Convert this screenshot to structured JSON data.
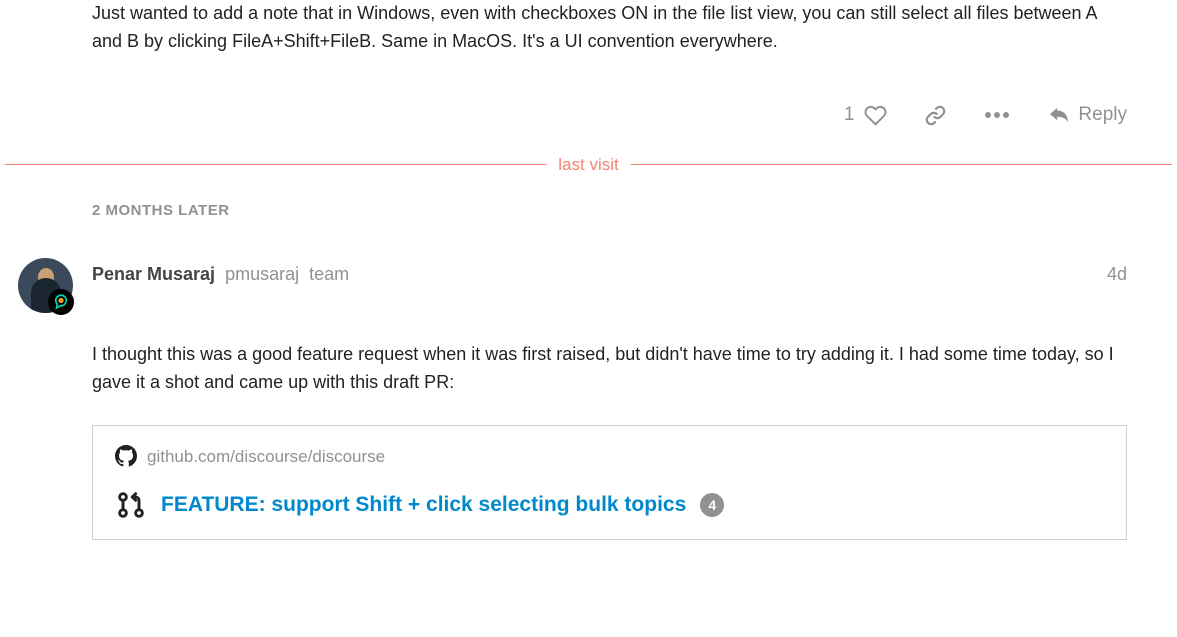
{
  "post1": {
    "text": "Just wanted to add a note that in Windows, even with checkboxes ON in the file list view, you can still select all files between A and B by clicking FileA+Shift+FileB. Same in MacOS. It's a UI convention everywhere.",
    "like_count": "1",
    "reply_label": "Reply"
  },
  "divider": {
    "label": "last visit"
  },
  "time_gap": "2 MONTHS LATER",
  "post2": {
    "author_name": "Penar Musaraj",
    "author_username": "pmusaraj",
    "author_badge": "team",
    "age": "4d",
    "text": "I thought this was a good feature request when it was first raised, but didn't have time to try adding it. I had some time today, so I gave it a shot and came up with this draft PR:",
    "onebox": {
      "source": "github.com/discourse/discourse",
      "title": "FEATURE: support Shift + click selecting bulk topics",
      "count": "4"
    }
  }
}
